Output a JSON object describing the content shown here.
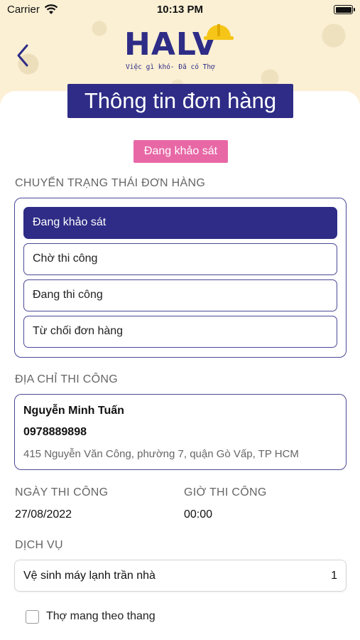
{
  "status_bar": {
    "carrier": "Carrier",
    "time": "10:13 PM"
  },
  "logo": {
    "name": "HALV",
    "tagline": "Việc gì khó- Đã có Thợ"
  },
  "page_title": "Thông tin đơn hàng",
  "current_status": "Đang khảo sát",
  "status_section": {
    "label": "CHUYỂN TRẠNG THÁI ĐƠN HÀNG",
    "options": [
      "Đang khảo sát",
      "Chờ thi công",
      "Đang thi công",
      "Từ chối đơn hàng"
    ],
    "selected": "Đang khảo sát"
  },
  "address_section": {
    "label": "ĐỊA CHỈ THI CÔNG",
    "name": "Nguyễn Minh Tuấn",
    "phone": "0978889898",
    "address": "415 Nguyễn Văn Công, phường 7, quận Gò Vấp, TP HCM"
  },
  "schedule": {
    "date_label": "NGÀY THI CÔNG",
    "date": "27/08/2022",
    "time_label": "GIỜ THI CÔNG",
    "time": "00:00"
  },
  "service_section": {
    "label": "DỊCH VỤ",
    "items": [
      {
        "name": "Vệ sinh máy lạnh trần nhà",
        "qty": "1"
      }
    ]
  },
  "ladder_option": {
    "label": "Thợ mang theo thang",
    "checked": false
  },
  "colors": {
    "primary": "#2e2c86",
    "badge": "#e868a6",
    "header_bg": "#fbf0d4",
    "helmet": "#f5c518"
  }
}
